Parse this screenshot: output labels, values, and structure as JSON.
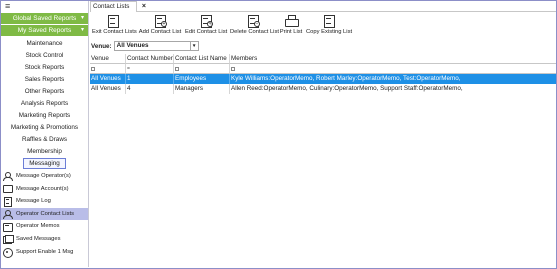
{
  "sidebar": {
    "menu_icon": "≡",
    "global_saved_reports": "Global Saved Reports",
    "my_saved_reports": "My Saved Reports",
    "chevron": "▾",
    "nav_items": [
      {
        "label": "Maintenance",
        "name": "sidebar-item-maintenance"
      },
      {
        "label": "Stock Control",
        "name": "sidebar-item-stock-control"
      },
      {
        "label": "Stock Reports",
        "name": "sidebar-item-stock-reports"
      },
      {
        "label": "Sales Reports",
        "name": "sidebar-item-sales-reports"
      },
      {
        "label": "Other Reports",
        "name": "sidebar-item-other-reports"
      },
      {
        "label": "Analysis Reports",
        "name": "sidebar-item-analysis-reports"
      },
      {
        "label": "Marketing Reports",
        "name": "sidebar-item-marketing-reports"
      },
      {
        "label": "Marketing & Promotions",
        "name": "sidebar-item-marketing-promotions"
      },
      {
        "label": "Raffles & Draws",
        "name": "sidebar-item-raffles-draws"
      },
      {
        "label": "Membership",
        "name": "sidebar-item-membership"
      },
      {
        "label": "Messaging",
        "name": "sidebar-item-messaging"
      }
    ],
    "operator_items": [
      {
        "label": "Message Operator(s)",
        "icon": "person-icon"
      },
      {
        "label": "Message Account(s)",
        "icon": "chat-bubble-icon"
      },
      {
        "label": "Message Log",
        "icon": "log-icon"
      },
      {
        "label": "Operator Contact Lists",
        "icon": "contacts-icon"
      },
      {
        "label": "Operator Memos",
        "icon": "memo-icon"
      },
      {
        "label": "Saved Messages",
        "icon": "saved-messages-icon"
      },
      {
        "label": "Support Enable 1 Msg",
        "icon": "support-icon"
      }
    ],
    "accent_green": "#7fba45",
    "active_bg": "#b9bde8"
  },
  "tab": {
    "label": "Contact Lists",
    "close": "×"
  },
  "toolbar": {
    "exit": "Exit Contact Lists",
    "add": "Add Contact List",
    "edit": "Edit Contact List",
    "delete": "Delete Contact List",
    "print": "Print List",
    "copy": "Copy Existing List"
  },
  "venue": {
    "label": "Venue:",
    "value": "All Venues",
    "dropdown": "▾"
  },
  "grid": {
    "headers": [
      "Venue",
      "Contact Number",
      "Contact List Name",
      "Members"
    ],
    "filter_ops": [
      "",
      "=",
      "",
      ""
    ],
    "rows": [
      [
        "All Venues",
        "1",
        "Employees",
        "Kyle  Williams:OperatorMemo, Robert  Marley:OperatorMemo, Test:OperatorMemo,"
      ],
      [
        "All Venues",
        "4",
        "Managers",
        "Allen  Reed:OperatorMemo, Culinary:OperatorMemo, Support Staff:OperatorMemo,"
      ]
    ],
    "selected_color": "#1e90e6"
  }
}
